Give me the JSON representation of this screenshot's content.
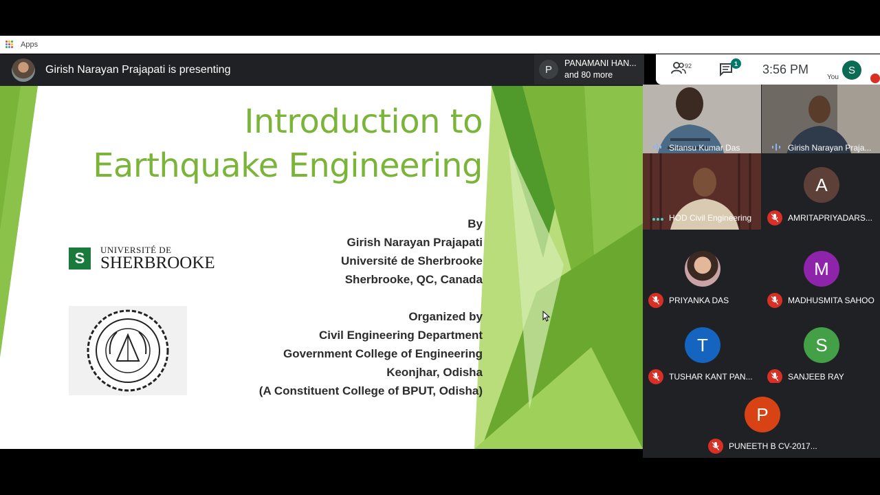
{
  "browser": {
    "apps_label": "Apps"
  },
  "meet": {
    "presenting_text": "Girish Narayan Prajapati is presenting",
    "others": {
      "initial": "P",
      "line1": "PANAMANI HAN...",
      "line2": "and 80 more"
    },
    "people_count": "92",
    "chat_badge": "1",
    "time": "3:56 PM",
    "you_label": "You",
    "you_initial": "S"
  },
  "slide": {
    "title_line1": "Introduction to",
    "title_line2": "Earthquake Engineering",
    "by": [
      "By",
      "Girish Narayan Prajapati",
      "Université de Sherbrooke",
      "Sherbrooke, QC, Canada"
    ],
    "organized": [
      "Organized by",
      "Civil Engineering Department",
      "Government College of Engineering",
      "Keonjhar, Odisha",
      "(A Constituent College of BPUT, Odisha)"
    ],
    "sherbrooke_logo": {
      "mark": "S",
      "line1": "UNIVERSITÉ DE",
      "line2": "SHERBROOKE"
    },
    "gce_logo": {
      "top_text": "GYANAM ANANTAM",
      "center_text": "ज्ञानम् अनन्तम्",
      "ring_text": "GOVERNMENT COLLEGE OF ENGINEERING, KEONJHAR"
    },
    "accent_color": "#7ab53a"
  },
  "participants": [
    {
      "name": "Sitansu Kumar Das",
      "type": "video",
      "status": "speaking"
    },
    {
      "name": "Girish Narayan Praja...",
      "type": "video",
      "status": "speaking"
    },
    {
      "name": "HOD Civil Engineering",
      "type": "video",
      "status": "dots"
    },
    {
      "name": "AMRITAPRIYADARS...",
      "initial": "A",
      "color": "#5d4037",
      "status": "muted"
    },
    {
      "name": "PRIYANKA DAS",
      "type": "photo",
      "status": "muted"
    },
    {
      "name": "MADHUSMITA SAHOO",
      "initial": "M",
      "color": "#8e24aa",
      "status": "muted"
    },
    {
      "name": "TUSHAR KANT PAN...",
      "initial": "T",
      "color": "#1565c0",
      "status": "muted"
    },
    {
      "name": "SANJEEB RAY",
      "initial": "S",
      "color": "#43a047",
      "status": "muted"
    },
    {
      "name": "PUNEETH B CV-2017...",
      "initial": "P",
      "color": "#d84315",
      "status": "muted"
    }
  ]
}
